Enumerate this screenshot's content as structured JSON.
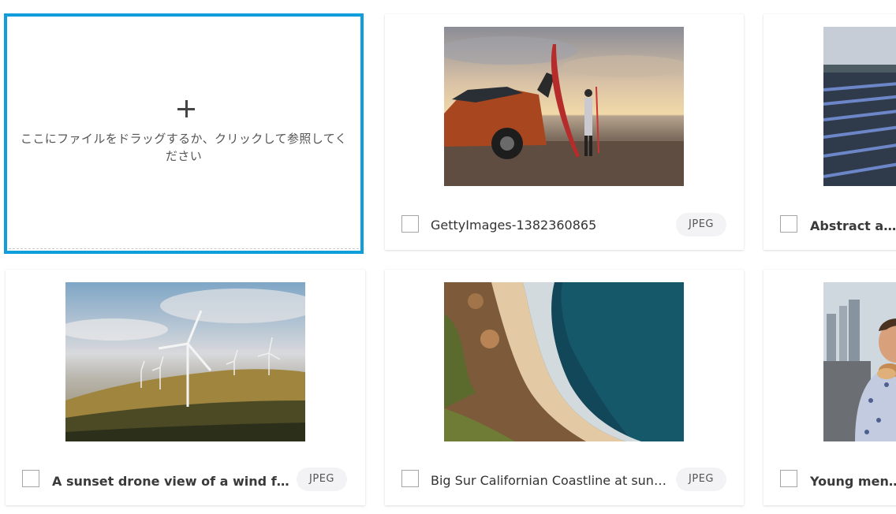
{
  "upload": {
    "instruction": "ここにファイルをドラッグするか、クリックして参照してください"
  },
  "assets": [
    {
      "name": "GettyImages-1382360865",
      "type": "JPEG",
      "image": "suv-paddleboard-beach-sunset-photo"
    },
    {
      "name": "Abstract aeria",
      "type": "",
      "image": "solar-farm-aerial-photo"
    },
    {
      "name": "A sunset drone view of a wind farm ...",
      "type": "JPEG",
      "image": "wind-farm-hills-photo"
    },
    {
      "name": "Big Sur Californian Coastline at sunset.",
      "type": "JPEG",
      "image": "coastline-aerial-photo"
    },
    {
      "name": "Young men ea",
      "type": "",
      "image": "man-eating-city-photo"
    }
  ],
  "colors": {
    "selection_border": "#0f9ddc",
    "badge_bg": "#f3f3f5"
  }
}
